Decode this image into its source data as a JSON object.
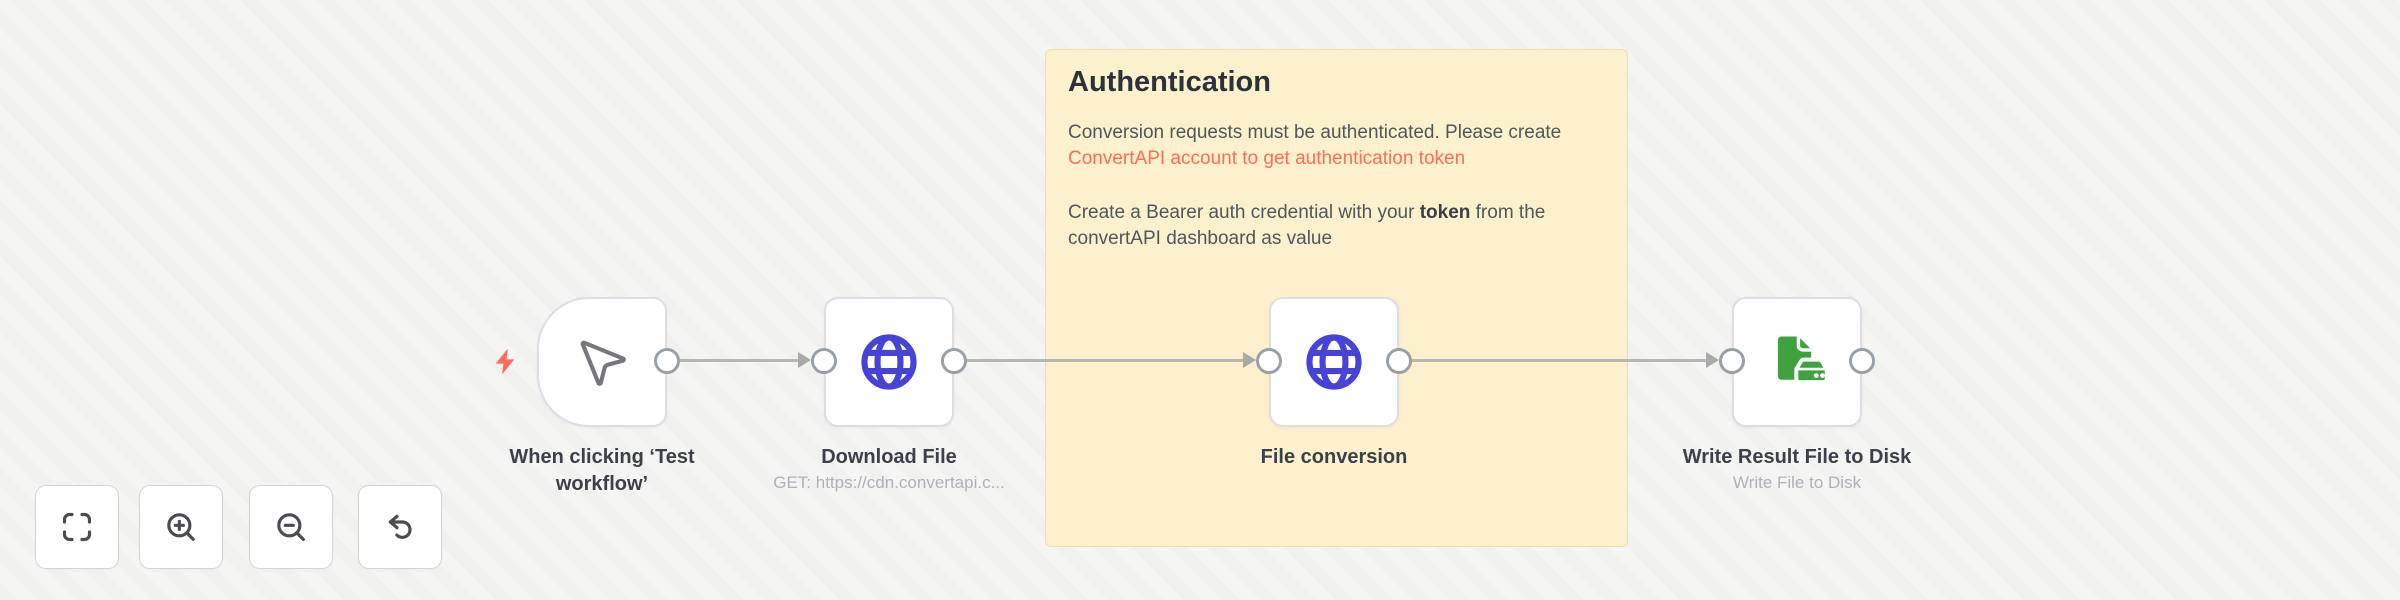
{
  "sticky": {
    "title": "Authentication",
    "p1_text": "Conversion requests must be authenticated. Please create",
    "p1_link": "ConvertAPI account to get authentication token",
    "p2_pre": "Create a Bearer auth credential with your ",
    "p2_bold": "token",
    "p2_post": " from the convertAPI dashboard as value"
  },
  "nodes": {
    "trigger": {
      "label": "When clicking ‘Test workflow’"
    },
    "download": {
      "label": "Download File",
      "subtitle": "GET: https://cdn.convertapi.c..."
    },
    "convert": {
      "label": "File conversion"
    },
    "write": {
      "label": "Write Result File to Disk",
      "subtitle": "Write File to Disk"
    }
  },
  "controls": [
    {
      "name": "zoom to fit",
      "icon": "zoom-to-fit-icon"
    },
    {
      "name": "zoom in",
      "icon": "zoom-in-icon"
    },
    {
      "name": "zoom out",
      "icon": "zoom-out-icon"
    },
    {
      "name": "undo",
      "icon": "undo-icon"
    }
  ],
  "icons": {
    "trigger_node": "mouse-cursor-icon",
    "download_node": "globe-icon",
    "convert_node": "globe-icon",
    "write_node": "file-to-disk-icon",
    "trigger_indicator": "lightning-bolt-icon"
  },
  "colors": {
    "accent": "#ff6d5a",
    "sticky_bg": "#fdf0cd",
    "sticky_border": "#eedfa9",
    "globe_blue": "#4743d6",
    "file_green": "#3fa23f",
    "canvas_bg": "#f5f5f3"
  }
}
